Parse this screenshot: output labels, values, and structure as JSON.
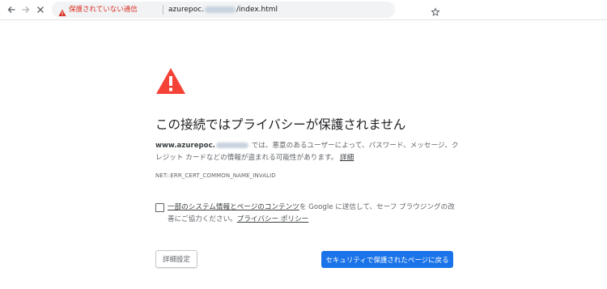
{
  "toolbar": {
    "insecure_label": "保護されていない通信",
    "url_prefix": "azurepoc.",
    "url_suffix": "/index.html",
    "icons": [
      "back-icon",
      "forward-icon",
      "close-icon",
      "warning-icon",
      "star-icon"
    ]
  },
  "interstitial": {
    "title": "この接続ではプライバシーが保護されません",
    "domain_prefix": "www.azurepoc.",
    "message": "では、悪意のあるユーザーによって、パスワード、メッセージ、クレジット カードなどの情報が盗まれる可能性があります。",
    "details_link": "詳細",
    "error_code": "NET::ERR_CERT_COMMON_NAME_INVALID",
    "optin_link": "一部のシステム情報とページのコンテンツ",
    "optin_text": "を Google に送信して、セーフ ブラウジングの改善にご協力ください。",
    "privacy_link": "プライバシー ポリシー",
    "details_button": "詳細設定",
    "primary_button": "セキュリティで保護されたページに戻る",
    "colors": {
      "warning_red": "#f44336",
      "primary_blue": "#1a73e8",
      "insecure_red": "#d93025"
    }
  }
}
